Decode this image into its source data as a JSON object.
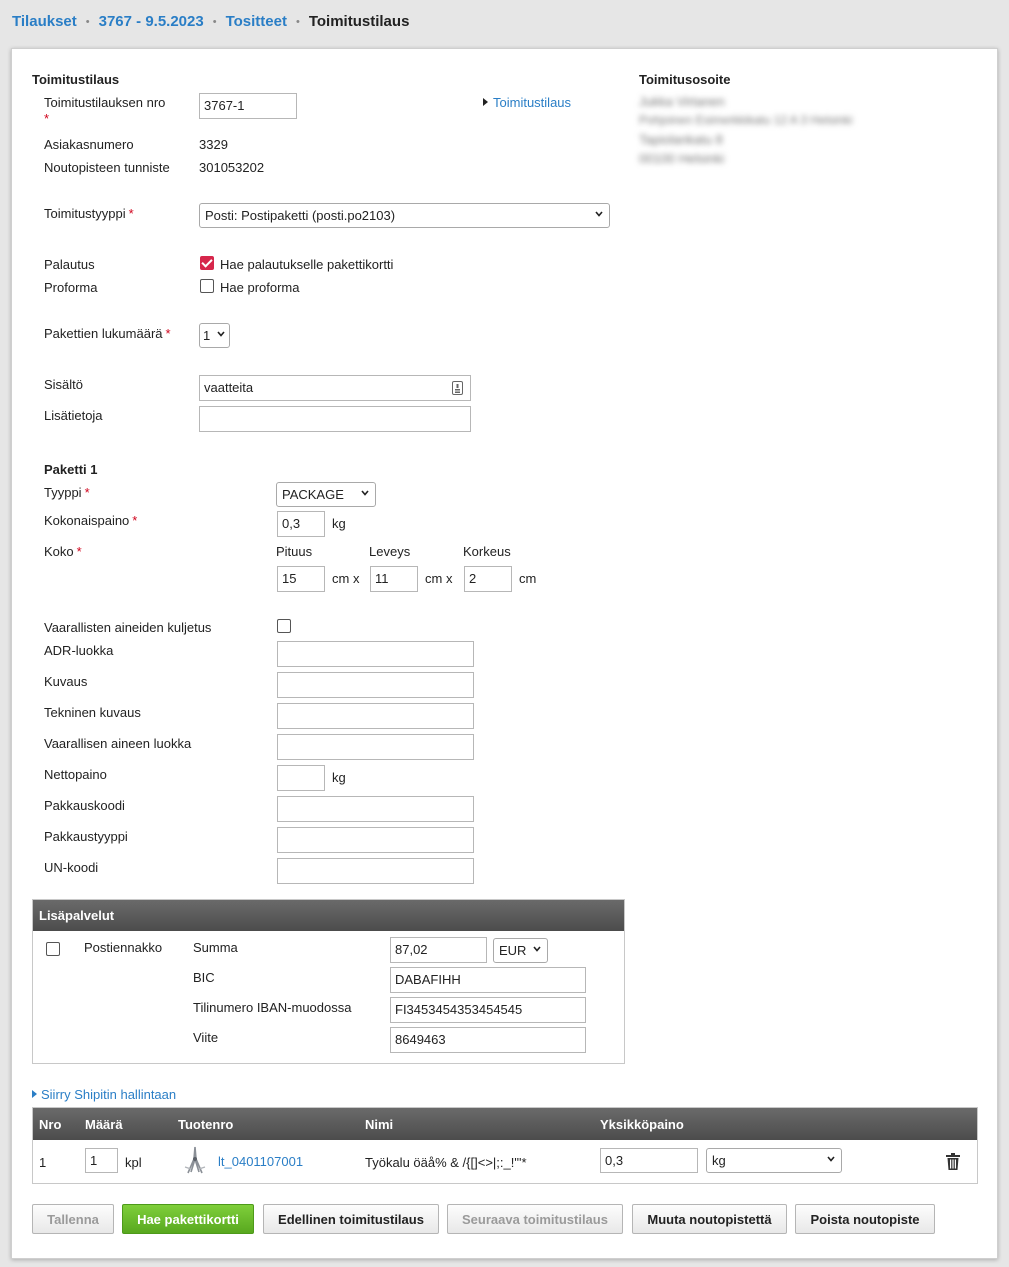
{
  "breadcrumb": {
    "items": [
      "Tilaukset",
      "3767 - 9.5.2023",
      "Tositteet"
    ],
    "current": "Toimitustilaus"
  },
  "form": {
    "section_title": "Toimitustilaus",
    "order_no_label": "Toimitustilauksen nro",
    "order_no_value": "3767-1",
    "order_link": "Toimitustilaus",
    "customer_no_label": "Asiakasnumero",
    "customer_no_value": "3329",
    "pickup_id_label": "Noutopisteen tunniste",
    "pickup_id_value": "301053202",
    "delivery_type_label": "Toimitustyyppi",
    "delivery_type_value": "Posti: Postipaketti (posti.po2103)",
    "return_label": "Palautus",
    "return_checkbox_label": "Hae palautukselle pakettikortti",
    "return_checked": true,
    "proforma_label": "Proforma",
    "proforma_checkbox_label": "Hae proforma",
    "proforma_checked": false,
    "package_count_label": "Pakettien lukumäärä",
    "package_count_value": "1",
    "contents_label": "Sisältö",
    "contents_value": "vaatteita",
    "extra_info_label": "Lisätietoja",
    "extra_info_value": ""
  },
  "address": {
    "title": "Toimitusosoite",
    "lines": [
      "Jukka Virtanen",
      "Pohjoinen Esimerkkikatu 12 A 3 Helsinki",
      "Tapiolankatu 8",
      "00100 Helsinki"
    ]
  },
  "package": {
    "title": "Paketti 1",
    "type_label": "Tyyppi",
    "type_value": "PACKAGE",
    "weight_label": "Kokonaispaino",
    "weight_value": "0,3",
    "weight_unit": "kg",
    "size_label": "Koko",
    "length_label": "Pituus",
    "width_label": "Leveys",
    "height_label": "Korkeus",
    "length_value": "15",
    "width_value": "11",
    "height_value": "2",
    "cm_x": "cm x",
    "cm": "cm"
  },
  "dangerous": {
    "transport_label": "Vaarallisten aineiden kuljetus",
    "adr_label": "ADR-luokka",
    "desc_label": "Kuvaus",
    "tech_desc_label": "Tekninen kuvaus",
    "class_label": "Vaarallisen aineen luokka",
    "net_weight_label": "Nettopaino",
    "net_weight_unit": "kg",
    "pack_code_label": "Pakkauskoodi",
    "pack_type_label": "Pakkaustyyppi",
    "un_code_label": "UN-koodi"
  },
  "services": {
    "title": "Lisäpalvelut",
    "cod_label": "Postiennakko",
    "amount_label": "Summa",
    "amount_value": "87,02",
    "currency_value": "EUR",
    "bic_label": "BIC",
    "bic_value": "DABAFIHH",
    "iban_label": "Tilinumero IBAN-muodossa",
    "iban_value": "FI3453454353454545",
    "ref_label": "Viite",
    "ref_value": "8649463"
  },
  "shipit_link": "Siirry Shipitin hallintaan",
  "products": {
    "headers": [
      "Nro",
      "Määrä",
      "Tuotenro",
      "Nimi",
      "Yksikköpaino"
    ],
    "rows": [
      {
        "nro": "1",
        "qty": "1",
        "unit": "kpl",
        "sku": "lt_0401107001",
        "name": "Työkalu öäå% & /{[]<>|;:_!\"'*",
        "weight": "0,3",
        "weight_unit": "kg"
      }
    ]
  },
  "buttons": {
    "save": "Tallenna",
    "get_card": "Hae pakettikortti",
    "prev": "Edellinen toimitustilaus",
    "next": "Seuraava toimitustilaus",
    "change_pickup": "Muuta noutopistettä",
    "delete_pickup": "Poista noutopiste"
  },
  "colors": {
    "link": "#2a7ec6",
    "required": "#d0021b",
    "checkbox_on": "#d6264b",
    "primary_green": "#6cbf2c"
  }
}
